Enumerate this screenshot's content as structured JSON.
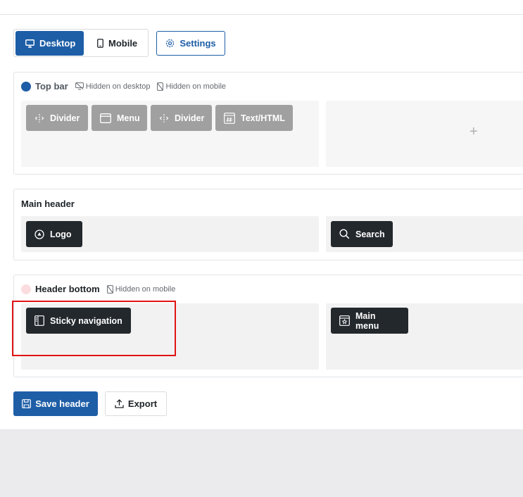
{
  "toolbar": {
    "desktop_label": "Desktop",
    "mobile_label": "Mobile",
    "settings_label": "Settings",
    "desktop_icon": "monitor-icon",
    "mobile_icon": "phone-icon",
    "settings_icon": "gear-icon"
  },
  "sections": {
    "top_bar": {
      "title": "Top bar",
      "hidden_desktop": "Hidden on desktop",
      "hidden_mobile": "Hidden on mobile",
      "left_items": [
        "Divider",
        "Menu",
        "Divider",
        "Text/HTML"
      ],
      "right_add": "+"
    },
    "main_header": {
      "title": "Main header",
      "left_items": [
        "Logo"
      ],
      "right_items": [
        "Search"
      ]
    },
    "header_bottom": {
      "title": "Header bottom",
      "hidden_mobile": "Hidden on mobile",
      "left_items": [
        "Sticky navigation"
      ],
      "right_items": [
        "Main menu"
      ]
    }
  },
  "actions": {
    "save_label": "Save header",
    "export_label": "Export"
  },
  "colors": {
    "accent": "#1e5ea7",
    "chip_dark": "#23282d",
    "chip_disabled": "#a0a0a0",
    "highlight": "#e01414"
  }
}
